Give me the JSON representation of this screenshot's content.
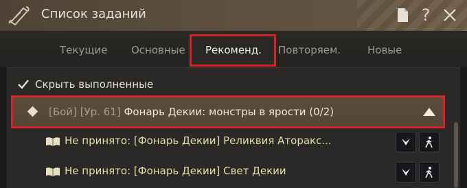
{
  "window": {
    "title": "Список заданий",
    "icons": [
      "scroll-logo-icon",
      "document-icon",
      "help-icon",
      "close-icon"
    ],
    "help_glyph": "?"
  },
  "tabs": [
    {
      "label": "Текущие",
      "active": false
    },
    {
      "label": "Основные",
      "active": false
    },
    {
      "label": "Рекоменд.",
      "active": true
    },
    {
      "label": "Повторяем.",
      "active": false
    },
    {
      "label": "Новые",
      "active": false
    }
  ],
  "filter": {
    "hide_completed_label": "Скрыть выполненные",
    "checked": true
  },
  "quest_group": {
    "tag_prefix": "[Бой] [Ур. 61] ",
    "name": "Фонарь Декии: монстры в ярости",
    "progress": "(0/2)",
    "expanded": true
  },
  "subquests": [
    {
      "text": "Не принято: [Фонарь Декии] Реликвия Аторакс..."
    },
    {
      "text": "Не принято: [Фонарь Декии] Свет Декии"
    }
  ],
  "colors": {
    "highlight_border": "#d8222a",
    "subquest_text": "#e4dfa6",
    "header_bg": "#5c4c3a"
  }
}
